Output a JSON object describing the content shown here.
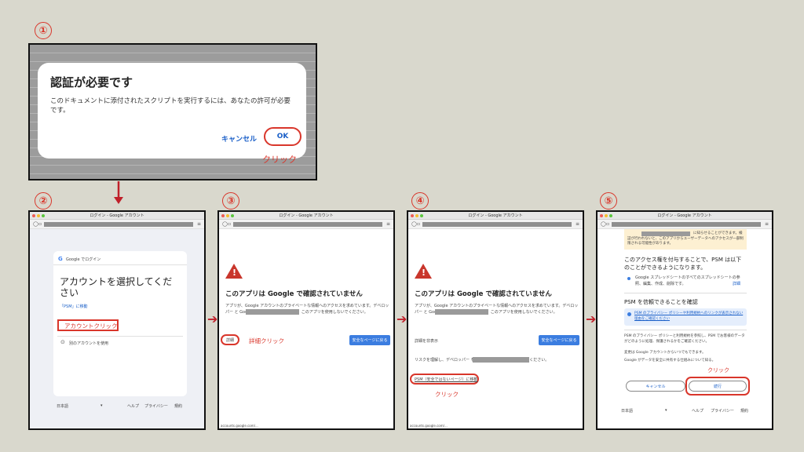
{
  "steps": [
    "①",
    "②",
    "③",
    "④",
    "⑤"
  ],
  "step1": {
    "dialog_title": "認証が必要です",
    "dialog_body": "このドキュメントに添付されたスクリプトを実行するには、あなたの許可が必要です。",
    "cancel": "キャンセル",
    "ok": "OK",
    "click": "クリック"
  },
  "browser": {
    "title": "ログイン - Google アカウント",
    "footer_url": "accounts.google.com/..."
  },
  "step2": {
    "google_login": "Google でログイン",
    "heading": "アカウントを選択してください",
    "move_to": "「PSM」に移動",
    "account_click": "アカウントクリック",
    "other_account": "別のアカウントを使用",
    "footer_lang": "日本語",
    "footer_help": "ヘルプ",
    "footer_privacy": "プライバシー",
    "footer_terms": "規約"
  },
  "step3": {
    "heading": "このアプリは Google で確認されていません",
    "body": "アプリが、Google アカウントのプライベートな情報へのアクセスを求めています。デベロッパー                      と Google によって確認されるまで、このアプリを使用しないでください。",
    "details": "詳細",
    "details_click": "詳細クリック",
    "back_safe": "安全なページに戻る"
  },
  "step4": {
    "heading": "このアプリは Google で確認されていません",
    "hide_details": "詳細を非表示",
    "back_safe": "安全なページに戻る",
    "risk_text": "リスクを理解し、デベロッパー                          を信頼できる場合のみ、続行してください。",
    "go_unsafe": "PSM（安全ではないページ）に移動",
    "click": "クリック"
  },
  "step5": {
    "top_text": "に知らせることができます。検証が行われないと、このアプリからユーザーデータへのアクセスが一部制限される可能性があります。",
    "grant_heading": "このアクセス権を付与することで、PSM は以下のことができるようになります。",
    "perm_item": "Google スプレッドシートのすべてのスプレッドシートの参照、編集、作成、削除です。",
    "perm_detail": "詳細",
    "trust_heading": "PSM を信頼できることを確認",
    "policy_note": "PSM のプライバシー ポリシーや利用規約へのリンクが表示されない理由をご確認ください",
    "info1": "PSM のプライバシー ポリシーと利用規約を参照し、PSM でお客様のデータがどのように処理、保護されるかをご確認ください。",
    "info2": "変更は Google アカウントからいつでもできます。",
    "info3": "Google がデータを安全に共有する仕組みについて知る。",
    "cancel": "キャンセル",
    "continue": "続行",
    "click": "クリック",
    "footer_lang": "日本語",
    "footer_help": "ヘルプ",
    "footer_privacy": "プライバシー",
    "footer_terms": "規約"
  },
  "colors": {
    "accent_red": "#d9362b",
    "arrow_red": "#c0202a",
    "google_blue": "#3b7de0",
    "background": "#d9d8cd"
  }
}
